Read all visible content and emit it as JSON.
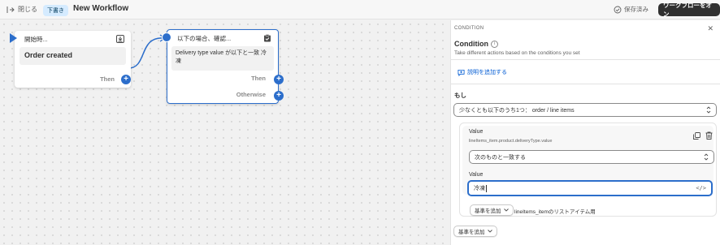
{
  "topbar": {
    "close_label": "閉じる",
    "draft_badge": "下書き",
    "title": "New Workflow",
    "saved_label": "保存済み",
    "turn_on_label": "ワークフローをオン"
  },
  "canvas": {
    "trigger_node": {
      "header": "開始時...",
      "event": "Order created",
      "then_label": "Then"
    },
    "condition_node": {
      "header": "以下の場合、確認...",
      "summary": "Delivery type value が以下と一致 冷凍",
      "then_label": "Then",
      "otherwise_label": "Otherwise"
    }
  },
  "panel": {
    "category": "CONDITION",
    "title": "Condition",
    "subtitle": "Take different actions based on the conditions you set",
    "add_description": "説明を追加する",
    "if_label": "もし",
    "condition_select": "少なくとも以下のうち1つ： order / line items",
    "criterion": {
      "value_label": "Value",
      "value_path": "lineItems_item.product.deliveryType.value",
      "operator": "次のものと一致する",
      "value2_label": "Value",
      "value_input": "冷凍",
      "code_symbol": "</>"
    },
    "add_criteria_inner": "基準を追加",
    "list_note": "lineItems_itemのリストアイテム用",
    "add_criteria_outer": "基準を追加"
  },
  "colors": {
    "accent": "#2c6ecb",
    "badge_bg": "#d5ebff",
    "dark_button": "#303030",
    "link": "#005bd3"
  }
}
